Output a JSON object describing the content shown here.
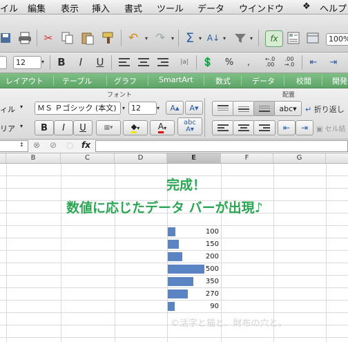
{
  "menubar": {
    "items": [
      "イル",
      "編集",
      "表示",
      "挿入",
      "書式",
      "ツール",
      "データ",
      "ウインドウ",
      "ヘルプ"
    ]
  },
  "toolbar": {
    "zoom": "100%",
    "font_size_small": "12",
    "icons": [
      "print-icon",
      "cut-icon",
      "copy-icon",
      "paste-icon",
      "format-painter-icon",
      "undo-icon",
      "redo-icon",
      "autosum-icon",
      "sort-icon",
      "filter-icon",
      "fx-icon",
      "gallery-icon",
      "toolbox-icon"
    ]
  },
  "toolbar2": {
    "font_size": "12",
    "bold": "B",
    "italic": "I",
    "underline": "U"
  },
  "ribbon_tabs": [
    "レイアウト",
    "テーブル",
    "グラフ",
    "SmartArt",
    "数式",
    "データ",
    "校閲",
    "開発"
  ],
  "ribbon": {
    "group_font": "フォント",
    "group_align": "配置",
    "left_label_1": "ィル",
    "left_label_2": "リア",
    "font_name": "ＭＳ Ｐゴシック (本文)",
    "font_size": "12",
    "bold": "B",
    "italic": "I",
    "underline": "U",
    "text_orient": "abc",
    "wrap_text": "折り返し",
    "merge": "セル結"
  },
  "formula_bar": {
    "fx": "fx",
    "value": ""
  },
  "columns": [
    {
      "label": "",
      "selected": false
    },
    {
      "label": "B",
      "selected": false
    },
    {
      "label": "C",
      "selected": false
    },
    {
      "label": "D",
      "selected": false
    },
    {
      "label": "E",
      "selected": true
    },
    {
      "label": "F",
      "selected": false
    },
    {
      "label": "G",
      "selected": false
    }
  ],
  "sheet": {
    "title_line1": "完成！",
    "title_line2": "数値に応じたデータ バーが出現♪",
    "watermark": "©活字と猫と、財布の穴と。"
  },
  "chart_data": {
    "type": "bar",
    "values": [
      100,
      150,
      200,
      500,
      350,
      270,
      90
    ],
    "labels": [
      "100",
      "150",
      "200",
      "500",
      "350",
      "270",
      "90"
    ],
    "max": 500,
    "colors": {
      "bar": "#5b84c4",
      "title": "#2aa653"
    }
  }
}
